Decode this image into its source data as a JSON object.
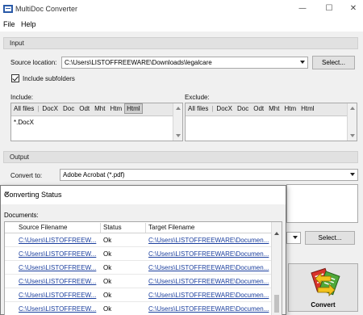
{
  "window": {
    "title": "MultiDoc Converter",
    "minimize": "—",
    "maximize": "☐",
    "close": "✕"
  },
  "menu": [
    "File",
    "Help"
  ],
  "input": {
    "header": "Input",
    "source_label": "Source location:",
    "source_value": "C:\\Users\\LISTOFFREEWARE\\Downloads\\legalcare",
    "select_label": "Select...",
    "include_subfolders": "Include subfolders",
    "include_subfolders_checked": true,
    "include_label": "Include:",
    "exclude_label": "Exclude:",
    "include_tabs": [
      "All files",
      "DocX",
      "Doc",
      "Odt",
      "Mht",
      "Htm",
      "Html"
    ],
    "include_selected": "Html",
    "include_text": "*.DocX",
    "exclude_tabs": [
      "All files",
      "DocX",
      "Doc",
      "Odt",
      "Mht",
      "Htm",
      "Html"
    ],
    "exclude_text": ""
  },
  "output": {
    "header": "Output",
    "convert_to_label": "Convert to:",
    "convert_to_value": "Adobe Acrobat (*.pdf)",
    "select_label": "Select..."
  },
  "convert_button": {
    "label": "Convert",
    "icon": "convert-files-icon"
  },
  "dialog": {
    "title": "Converting Status",
    "documents_label": "Documents:",
    "columns": [
      "Source Filename",
      "Status",
      "Target Filename"
    ],
    "rows": [
      {
        "source": "C:\\Users\\LISTOFFREEW...",
        "status": "Ok",
        "target": "C:\\Users\\LISTOFFREEWARE\\Documen..."
      },
      {
        "source": "C:\\Users\\LISTOFFREEW...",
        "status": "Ok",
        "target": "C:\\Users\\LISTOFFREEWARE\\Documen..."
      },
      {
        "source": "C:\\Users\\LISTOFFREEW...",
        "status": "Ok",
        "target": "C:\\Users\\LISTOFFREEWARE\\Documen..."
      },
      {
        "source": "C:\\Users\\LISTOFFREEW...",
        "status": "Ok",
        "target": "C:\\Users\\LISTOFFREEWARE\\Documen..."
      },
      {
        "source": "C:\\Users\\LISTOFFREEW...",
        "status": "Ok",
        "target": "C:\\Users\\LISTOFFREEWARE\\Documen..."
      },
      {
        "source": "C:\\Users\\LISTOFFREEW...",
        "status": "Ok",
        "target": "C:\\Users\\LISTOFFREEWARE\\Documen..."
      }
    ],
    "close": "✕"
  },
  "colors": {
    "link": "#1a3e9e",
    "background": "#f0f0f0",
    "header": "#e1e1e1"
  }
}
